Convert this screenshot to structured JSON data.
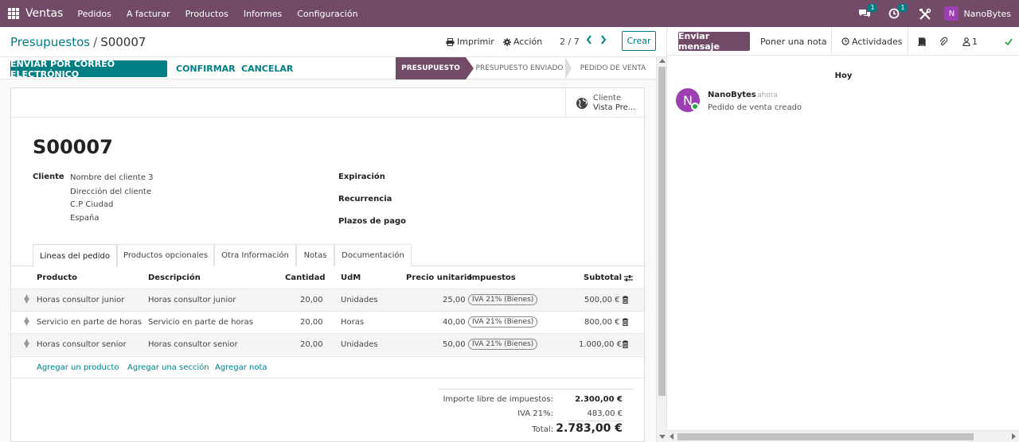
{
  "colors": {
    "brand": "#714b67",
    "accent": "#017e84"
  },
  "navbar": {
    "app_name": "Ventas",
    "menu": [
      "Pedidos",
      "A facturar",
      "Productos",
      "Informes",
      "Configuración"
    ],
    "messages_badge": "1",
    "activities_badge": "1",
    "user_initial": "N",
    "user_name": "NanoBytes"
  },
  "control_panel": {
    "breadcrumb_parent": "Presupuestos",
    "breadcrumb_sep": "/",
    "breadcrumb_current": "S00007",
    "print_label": "Imprimir",
    "action_label": "Acción",
    "pager": "2 / 7",
    "create_label": "Crear"
  },
  "actions": {
    "send_email": "ENVIAR POR CORREO ELECTRÓNICO",
    "confirm": "CONFIRMAR",
    "cancel": "CANCELAR"
  },
  "statusbar": [
    "PRESUPUESTO",
    "PRESUPUESTO ENVIADO",
    "PEDIDO DE VENTA"
  ],
  "smart_button": {
    "line1": "Cliente",
    "line2": "Vista Pre..."
  },
  "form": {
    "title": "S00007",
    "customer_label": "Cliente",
    "customer_lines": [
      "Nombre del cliente 3",
      "Dirección del cliente",
      "C.P Ciudad",
      "España"
    ],
    "expiration_label": "Expiración",
    "recurrence_label": "Recurrencia",
    "payment_terms_label": "Plazos de pago"
  },
  "tabs": [
    "Líneas del pedido",
    "Productos opcionales",
    "Otra Información",
    "Notas",
    "Documentación"
  ],
  "lines": {
    "headers": {
      "product": "Producto",
      "description": "Descripción",
      "quantity": "Cantidad",
      "uom": "UdM",
      "unit_price": "Precio unitario",
      "taxes": "Impuestos",
      "subtotal": "Subtotal"
    },
    "rows": [
      {
        "product": "Horas consultor junior",
        "description": "Horas consultor junior",
        "quantity": "20,00",
        "uom": "Unidades",
        "unit_price": "25,00",
        "tax": "IVA 21% (Bienes)",
        "subtotal": "500,00 €"
      },
      {
        "product": "Servicio en parte de horas",
        "description": "Servicio en parte de horas",
        "quantity": "20,00",
        "uom": "Horas",
        "unit_price": "40,00",
        "tax": "IVA 21% (Bienes)",
        "subtotal": "800,00 €"
      },
      {
        "product": "Horas consultor senior",
        "description": "Horas consultor senior",
        "quantity": "20,00",
        "uom": "Unidades",
        "unit_price": "50,00",
        "tax": "IVA 21% (Bienes)",
        "subtotal": "1.000,00 €"
      }
    ],
    "add_product": "Agregar un producto",
    "add_section": "Agregar una sección",
    "add_note": "Agregar nota"
  },
  "totals": {
    "untaxed_label": "Importe libre de impuestos:",
    "untaxed_value": "2.300,00 €",
    "tax_label": "IVA 21%:",
    "tax_value": "483,00 €",
    "total_label": "Total:",
    "total_value": "2.783,00 €"
  },
  "chatter": {
    "send_message": "Enviar mensaje",
    "log_note": "Poner una nota",
    "activities": "Actividades",
    "followers_count": "1",
    "date_separator": "Hoy",
    "message": {
      "avatar_initial": "N",
      "author": "NanoBytes",
      "time": "- ahora",
      "body": "Pedido de venta creado"
    }
  }
}
